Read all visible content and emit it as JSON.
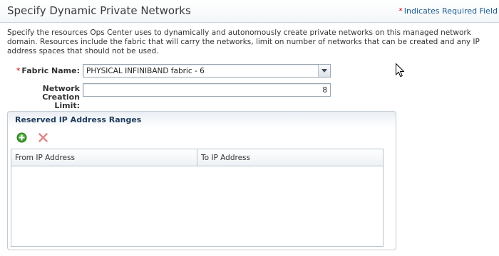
{
  "header": {
    "title": "Specify Dynamic Private Networks",
    "required_marker": "*",
    "required_note": "Indicates Required Field"
  },
  "description": "Specify the resources Ops Center uses to dynamically and autonomously create private networks on this managed network domain. Resources include the fabric that will carry the networks, limit on number of networks that can be created and any IP address spaces that should not be used.",
  "form": {
    "fabric": {
      "required_marker": "*",
      "label": "Fabric Name:",
      "selected": "PHYSICAL INFINIBAND fabric - 6"
    },
    "limit": {
      "label_line1": "Network Creation",
      "label_line2": "Limit:",
      "value": "8"
    }
  },
  "reserved_panel": {
    "title": "Reserved IP Address Ranges",
    "toolbar": {
      "add_icon": "add-icon",
      "delete_icon": "delete-icon"
    },
    "columns": [
      "From IP Address",
      "To IP Address"
    ],
    "rows": []
  },
  "colors": {
    "required_star": "#cc0000",
    "link_blue": "#1c5c8f",
    "add_green": "#3a9a2a",
    "delete_red": "#e08a8a"
  }
}
